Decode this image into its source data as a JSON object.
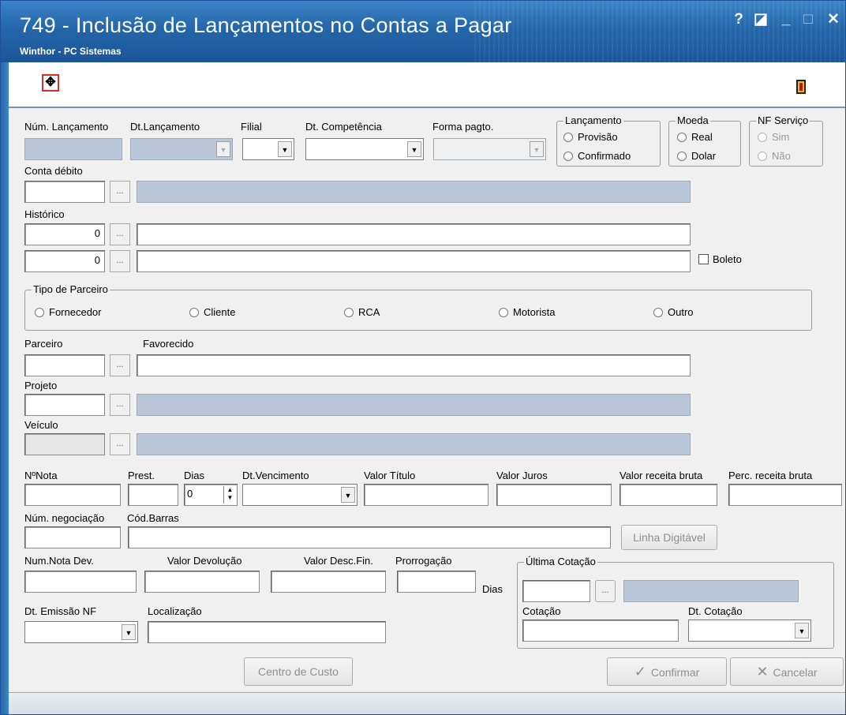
{
  "window": {
    "title": "749 - Inclusão de Lançamentos no Contas a Pagar",
    "subtitle": "Winthor - PC Sistemas",
    "controls": {
      "help": "?",
      "restore": "◪",
      "minimize": "_",
      "maximize": "□",
      "close": "✕"
    }
  },
  "toolbar": {
    "add_icon": "plus-icon",
    "exit_icon": "exit-door-icon",
    "add_glyph": "✥"
  },
  "labels": {
    "num_lancamento": "Núm. Lançamento",
    "dt_lancamento": "Dt.Lançamento",
    "filial": "Filial",
    "dt_competencia": "Dt. Competência",
    "forma_pagto": "Forma pagto.",
    "conta_debito": "Conta débito",
    "historico": "Histórico",
    "parceiro": "Parceiro",
    "favorecido": "Favorecido",
    "projeto": "Projeto",
    "veiculo": "Veículo",
    "num_nota": "NºNota",
    "prest": "Prest.",
    "dias": "Dias",
    "dt_vencimento": "Dt.Vencimento",
    "valor_titulo": "Valor Título",
    "valor_juros": "Valor Juros",
    "valor_receita_bruta": "Valor receita bruta",
    "perc_receita_bruta": "Perc. receita bruta",
    "num_negociacao": "Núm. negociação",
    "cod_barras": "Cód.Barras",
    "num_nota_dev": "Num.Nota Dev.",
    "valor_devolucao": "Valor Devolução",
    "valor_desc_fin": "Valor Desc.Fin.",
    "prorrogacao": "Prorrogação",
    "dias_suffix": "Dias",
    "dt_emissao_nf": "Dt. Emissão NF",
    "localizacao": "Localização",
    "cotacao": "Cotação",
    "dt_cotacao": "Dt. Cotação"
  },
  "lancamento": {
    "title": "Lançamento",
    "options": [
      "Provisão",
      "Confirmado"
    ]
  },
  "moeda": {
    "title": "Moeda",
    "options": [
      "Real",
      "Dolar"
    ]
  },
  "nf_servico": {
    "title": "NF Serviço",
    "options": [
      "Sim",
      "Não"
    ]
  },
  "tipo_parceiro": {
    "title": "Tipo de Parceiro",
    "options": [
      "Fornecedor",
      "Cliente",
      "RCA",
      "Motorista",
      "Outro"
    ]
  },
  "historico": {
    "value1": "0",
    "value2": "0",
    "boleto_label": "Boleto"
  },
  "dias_value": "0",
  "ultima_cotacao": {
    "title": "Última Cotação"
  },
  "buttons": {
    "ellipsis": "...",
    "linha_digitavel": "Linha Digitável",
    "centro_custo": "Centro de Custo",
    "confirmar": "Confirmar",
    "cancelar": "Cancelar",
    "confirm_glyph": "✓",
    "cancel_glyph": "✕"
  },
  "colors": {
    "titlebar": "#2466aa",
    "disabled_field": "#b9c7d8"
  }
}
